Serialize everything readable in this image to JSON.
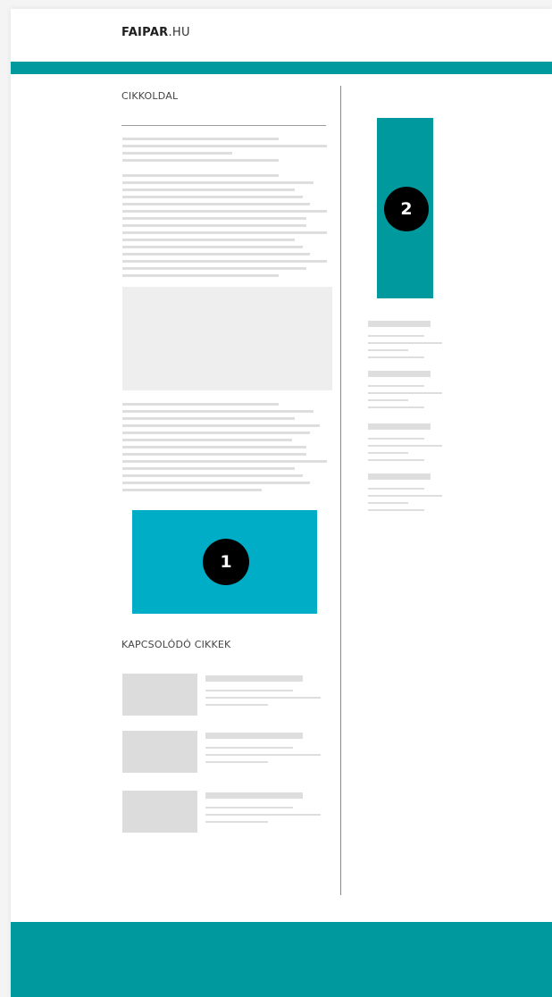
{
  "header": {
    "logo_bold": "FAIPAR",
    "logo_tld": ".HU"
  },
  "main": {
    "section_title": "CIKKOLDAL",
    "ad_slot_1_number": "1"
  },
  "related": {
    "title": "KAPCSOLÓDÓ CIKKEK",
    "items_count_shown": 3
  },
  "sidebar": {
    "ad_slot_2_number": "2"
  },
  "colors": {
    "brand_teal": "#009a9e",
    "ad_cyan": "#00adc7",
    "placeholder_gray": "#dedede"
  }
}
